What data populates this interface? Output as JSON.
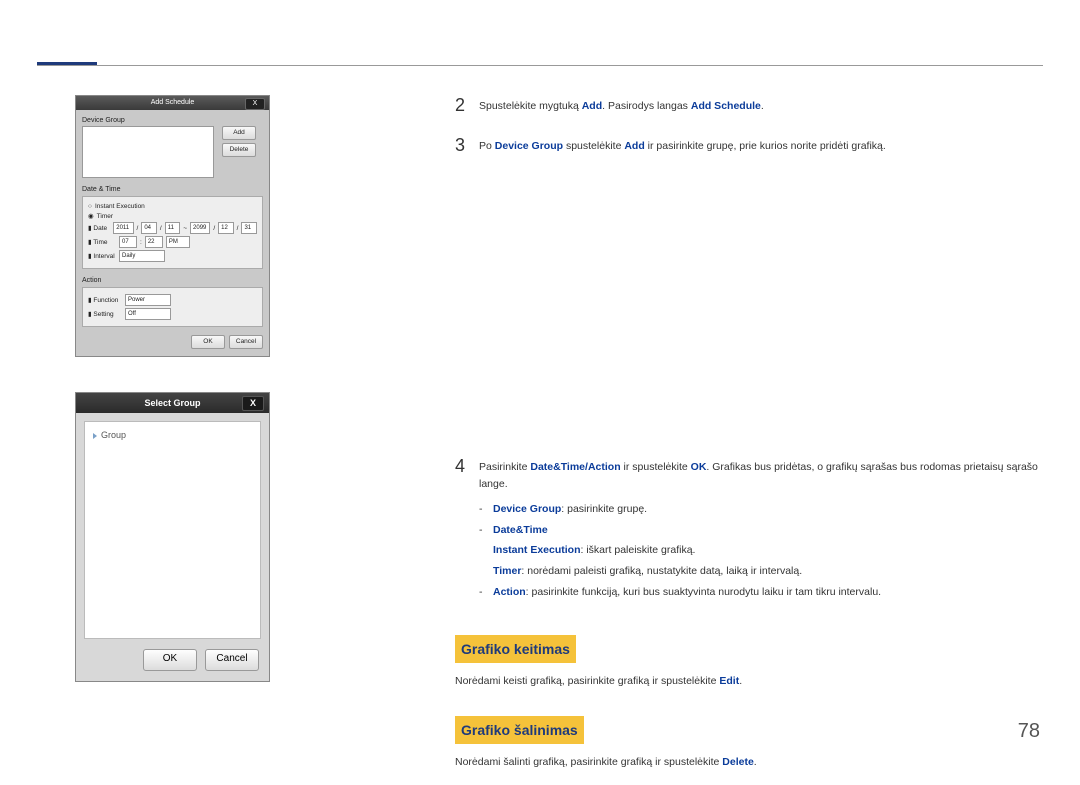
{
  "page_number": "78",
  "dialog_add_schedule": {
    "title": "Add Schedule",
    "close_x": "X",
    "device_group_label": "Device Group",
    "btn_add": "Add",
    "btn_delete": "Delete",
    "date_time_label": "Date & Time",
    "radio_instant": "Instant Execution",
    "radio_timer": "Timer",
    "row_date": "Date",
    "date_y": "2011",
    "date_m": "04",
    "date_d": "11",
    "date_y2": "2099",
    "date_m2": "12",
    "date_d2": "31",
    "row_time": "Time",
    "time_h": "07",
    "time_m": "22",
    "time_ampm": "PM",
    "row_interval": "Interval",
    "interval_val": "Daily",
    "action_label": "Action",
    "row_function": "Function",
    "function_val": "Power",
    "row_setting": "Setting",
    "setting_val": "Off",
    "btn_ok": "OK",
    "btn_cancel": "Cancel"
  },
  "dialog_select_group": {
    "title": "Select Group",
    "close_x": "X",
    "tree_root": "Group",
    "btn_ok": "OK",
    "btn_cancel": "Cancel"
  },
  "steps": {
    "s2": {
      "num": "2",
      "t1": "Spustelėkite mygtuką ",
      "b1": "Add",
      "t2": ". Pasirodys langas ",
      "b2": "Add Schedule",
      "t3": "."
    },
    "s3": {
      "num": "3",
      "t1": "Po ",
      "b1": "Device Group",
      "t2": " spustelėkite ",
      "b2": "Add",
      "t3": " ir pasirinkite grupę, prie kurios norite pridėti grafiką."
    },
    "s4": {
      "num": "4",
      "t1": "Pasirinkite ",
      "b1": "Date&Time",
      "sep": "/",
      "b2": "Action",
      "t2": " ir spustelėkite ",
      "b3": "OK",
      "t3": ". Grafikas bus pridėtas, o grafikų sąrašas bus rodomas prietaisų sąrašo lange.",
      "li1_b": "Device Group",
      "li1_t": ": pasirinkite grupę.",
      "li2_b": "Date&Time",
      "li2a_b": "Instant Execution",
      "li2a_t": ": iškart paleiskite grafiką.",
      "li2b_b": "Timer",
      "li2b_t": ": norėdami paleisti grafiką, nustatykite datą, laiką ir intervalą.",
      "li3_b": "Action",
      "li3_t": ": pasirinkite funkciją, kuri bus suaktyvinta nurodytu laiku ir tam tikru intervalu."
    }
  },
  "headings": {
    "edit_h": "Grafiko keitimas",
    "edit_p1": "Norėdami keisti grafiką, pasirinkite grafiką ir spustelėkite ",
    "edit_b": "Edit",
    "edit_p2": ".",
    "del_h": "Grafiko šalinimas",
    "del_p1": "Norėdami šalinti grafiką, pasirinkite grafiką ir spustelėkite ",
    "del_b": "Delete",
    "del_p2": "."
  }
}
